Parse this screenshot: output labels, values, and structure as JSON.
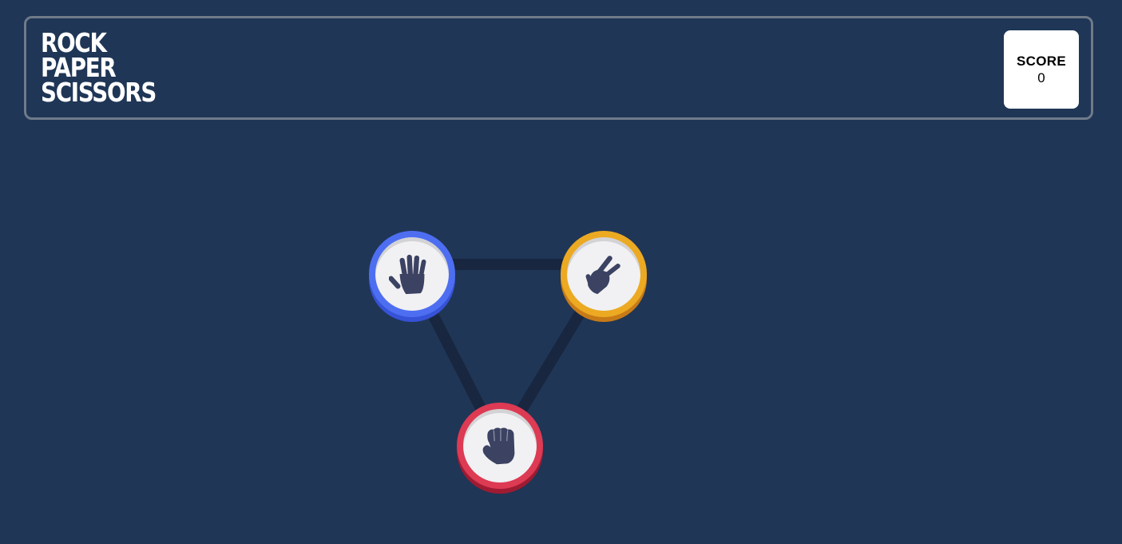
{
  "header": {
    "title_lines": [
      "ROCK",
      "PAPER",
      "SCISSORS"
    ]
  },
  "score": {
    "label": "SCORE",
    "value": "0"
  },
  "choices": [
    {
      "id": "paper",
      "icon": "paper-hand-icon",
      "ring_color": "#4e6ef2",
      "shade_color": "#3652d6"
    },
    {
      "id": "scissors",
      "icon": "scissors-hand-icon",
      "ring_color": "#eca922",
      "shade_color": "#c77a17"
    },
    {
      "id": "rock",
      "icon": "rock-fist-icon",
      "ring_color": "#dd3a54",
      "shade_color": "#9e1b32"
    }
  ],
  "colors": {
    "background": "#1f3656",
    "header_border": "#6f7a89",
    "triangle_line": "#18263f",
    "icon_fill": "#3b4262",
    "token_face": "#f1f1f3"
  }
}
